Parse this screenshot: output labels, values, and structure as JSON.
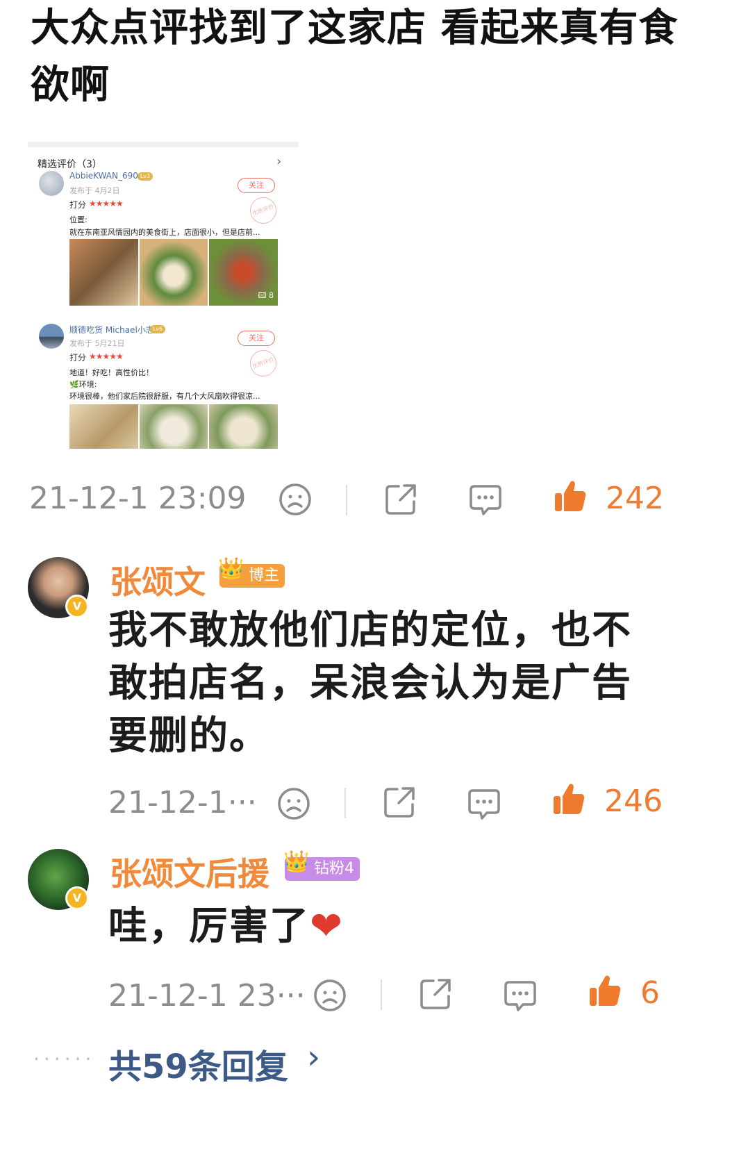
{
  "post": {
    "title": "大众点评找到了这家店 看起来真有食欲啊"
  },
  "embed": {
    "section_title": "精选评价（3）",
    "arrow": "›",
    "reviews": [
      {
        "user": "AbbieKWAN_6904",
        "level": "Lv3",
        "date": "发布于 4月2日",
        "follow": "关注",
        "stamp": "优质评价",
        "rate_label": "打分",
        "stars": "★★★★★",
        "text1": "位置:",
        "text2": "就在东南亚风情园内的美食街上，店面很小，但是店前...",
        "photo_count": "🖾 8"
      },
      {
        "user": "顺德吃货 Michael小志",
        "level": "Lv6",
        "date": "发布于 5月21日",
        "follow": "关注",
        "stamp": "优质评价",
        "rate_label": "打分",
        "stars": "★★★★★",
        "text1": "地道！好吃！高性价比！",
        "text1b": "🌿环境:",
        "text2": "环境很棒，他们家后院很舒服，有几个大风扇吹得很凉..."
      }
    ]
  },
  "post_bar": {
    "time": "21-12-1 23:09",
    "likes": "242"
  },
  "comments": [
    {
      "name": "张颂文",
      "badge": "博主",
      "badge_color": "#f5a03c",
      "text": "我不敢放他们店的定位，也不敢拍店名，呆浪会认为是广告要删的。",
      "time": "21-12-1···",
      "likes": "246"
    },
    {
      "name": "张颂文后援",
      "badge": "钻粉4",
      "badge_color": "#c78be8",
      "text": "哇，厉害了",
      "heart": "❤",
      "time": "21-12-1 23···",
      "likes": "6"
    }
  ],
  "footer": {
    "more_replies": "共59条回复",
    "chevron": "›",
    "dots": "······"
  },
  "icons": {
    "dislike": "sad-face-icon",
    "share": "share-icon",
    "comment": "comment-icon",
    "like": "thumbs-up-icon",
    "verified": "V"
  },
  "colors": {
    "accent_orange": "#f07a2e",
    "name_orange": "#f08a3a",
    "link_blue": "#3d5a86",
    "gray": "#8c8c8c"
  }
}
